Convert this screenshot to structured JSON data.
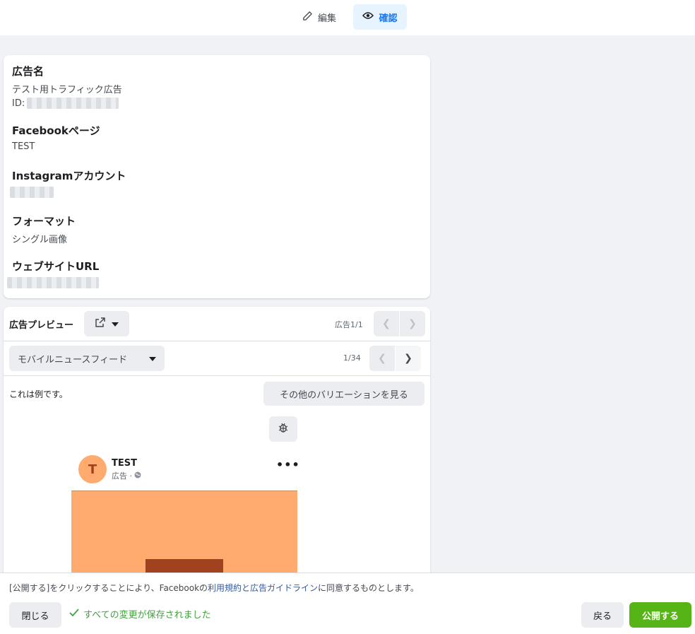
{
  "tabs": {
    "edit": "編集",
    "review": "確認"
  },
  "info": {
    "ad_name_title": "広告名",
    "ad_name_value": "テスト用トラフィック広告",
    "id_label": "ID:",
    "fb_page_title": "Facebookページ",
    "fb_page_value": "TEST",
    "instagram_title": "Instagramアカウント",
    "format_title": "フォーマット",
    "format_value": "シングル画像",
    "website_title": "ウェブサイトURL"
  },
  "preview": {
    "title": "広告プレビュー",
    "ad_count": "広告1/1",
    "placement": "モバイルニュースフィード",
    "placement_count": "1/34",
    "example_note": "これは例です。",
    "variations_button": "その他のバリエーションを見る",
    "post_name": "TEST",
    "post_sub": "広告 ·",
    "avatar_letter": "T"
  },
  "footer": {
    "terms_prefix": "[公開する]をクリックすることにより、Facebookの",
    "terms_link": "利用規約と広告ガイドライン",
    "terms_suffix": "に同意するものとします。",
    "close": "閉じる",
    "saved": "すべての変更が保存されました",
    "back": "戻る",
    "publish": "公開する"
  },
  "colors": {
    "accent": "#1877f2",
    "publish": "#56b416",
    "avatar_bg": "#ffaa6e",
    "avatar_fg": "#a0411f",
    "saved": "#42a23e"
  }
}
